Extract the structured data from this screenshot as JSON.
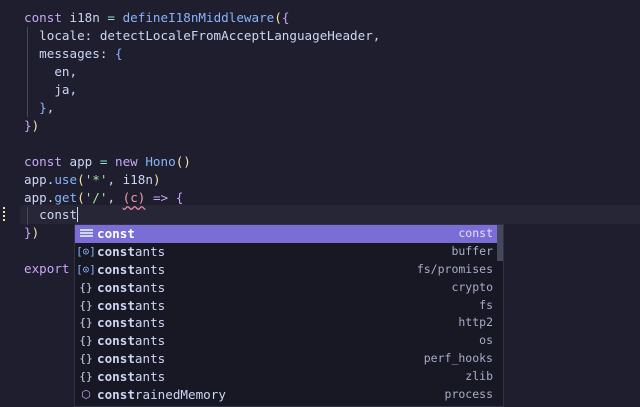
{
  "code": {
    "l1": {
      "a": "const ",
      "b": "i18n",
      "c": " = ",
      "d": "defineI18nMiddleware",
      "e": "(",
      "f": "{"
    },
    "l2": {
      "a": "  locale: ",
      "b": "detectLocaleFromAcceptLanguageHeader",
      "c": ","
    },
    "l3": {
      "a": "  messages: ",
      "b": "{"
    },
    "l4": {
      "a": "    en,"
    },
    "l5": {
      "a": "    ja,"
    },
    "l6": {
      "a": "  ",
      "b": "}",
      "c": ","
    },
    "l7": {
      "a": "}",
      "b": ")"
    },
    "l9": {
      "a": "const ",
      "b": "app",
      "c": " = ",
      "d": "new ",
      "e": "Hono",
      "f": "()"
    },
    "l10": {
      "a": "app.",
      "b": "use",
      "c": "(",
      "d": "'*'",
      "e": ", i18n",
      "f": ")"
    },
    "l11": {
      "a": "app.",
      "b": "get",
      "c": "(",
      "d": "'/'",
      "e": ", ",
      "f": "(c)",
      "g": " => ",
      "h": "{"
    },
    "l12": {
      "a": "  const"
    },
    "l13": {
      "a": "}",
      "b": ")"
    },
    "l15": {
      "a": "export"
    }
  },
  "suggest": {
    "items": [
      {
        "icon": "keyword-icon",
        "match": "const",
        "rest": "",
        "detail": "const",
        "selected": true
      },
      {
        "icon": "variable-icon",
        "match": "const",
        "rest": "ants",
        "detail": "buffer"
      },
      {
        "icon": "variable-icon",
        "match": "const",
        "rest": "ants",
        "detail": "fs/promises"
      },
      {
        "icon": "module-icon",
        "match": "const",
        "rest": "ants",
        "detail": "crypto"
      },
      {
        "icon": "module-icon",
        "match": "const",
        "rest": "ants",
        "detail": "fs"
      },
      {
        "icon": "module-icon",
        "match": "const",
        "rest": "ants",
        "detail": "http2"
      },
      {
        "icon": "module-icon",
        "match": "const",
        "rest": "ants",
        "detail": "os"
      },
      {
        "icon": "module-icon",
        "match": "const",
        "rest": "ants",
        "detail": "perf_hooks"
      },
      {
        "icon": "module-icon",
        "match": "const",
        "rest": "ants",
        "detail": "zlib"
      },
      {
        "icon": "method-icon",
        "match": "const",
        "rest": "rainedMemory",
        "detail": "process"
      }
    ]
  },
  "colors": {
    "background": "#1e1e2e",
    "selection": "#7a6dd6",
    "keyword": "#cba6f7",
    "function": "#89b4fa",
    "string": "#a6e3a1"
  }
}
